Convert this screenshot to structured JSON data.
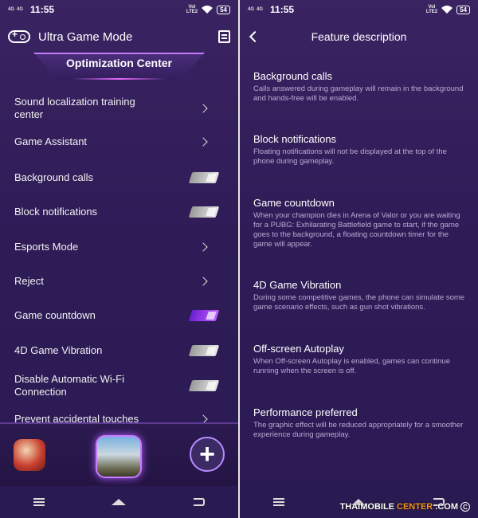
{
  "status_bar": {
    "network": "4G",
    "time": "11:55",
    "volte_top": "Vol",
    "volte_bottom": "LTE2",
    "battery": "54"
  },
  "left_panel": {
    "title": "Ultra Game Mode",
    "section_title": "Optimization Center",
    "items": [
      {
        "label": "Sound localization training center",
        "control": "chevron"
      },
      {
        "label": "Game Assistant",
        "control": "chevron"
      },
      {
        "label": "Background calls",
        "control": "toggle",
        "on": false
      },
      {
        "label": "Block notifications",
        "control": "toggle",
        "on": false
      },
      {
        "label": "Esports Mode",
        "control": "chevron"
      },
      {
        "label": "Reject",
        "control": "chevron"
      },
      {
        "label": "Game countdown",
        "control": "toggle",
        "on": true
      },
      {
        "label": "4D Game Vibration",
        "control": "toggle",
        "on": false
      },
      {
        "label": "Disable Automatic Wi-Fi Connection",
        "control": "toggle",
        "on": false
      },
      {
        "label": "Prevent accidental touches",
        "control": "chevron"
      }
    ],
    "dock": {
      "apps": [
        "game-app-icon-1",
        "game-app-icon-2"
      ],
      "add_icon": "plus-icon"
    }
  },
  "right_panel": {
    "title": "Feature description",
    "features": [
      {
        "name": "Background calls",
        "desc": "Calls answered during gameplay will remain in the background and hands-free will be enabled."
      },
      {
        "name": "Block notifications",
        "desc": "Floating notifications will not be displayed at the top of the phone during gameplay."
      },
      {
        "name": "Game countdown",
        "desc": "When your champion dies in Arena of Valor or you are waiting for a PUBG: Exhilarating Battlefield game to start, if the game goes to the background, a floating countdown timer for the game will appear."
      },
      {
        "name": "4D Game Vibration",
        "desc": "During some competitive games, the phone can simulate some game scenario effects, such as gun shot vibrations."
      },
      {
        "name": "Off-screen Autoplay",
        "desc": "When Off-screen Autoplay is enabled, games can continue running when the screen is off."
      },
      {
        "name": "Performance preferred",
        "desc": "The graphic effect will be reduced appropriately for a smoother experience during gameplay."
      }
    ]
  },
  "watermark": {
    "prefix": "THAIMOBILE",
    "highlight": "CENTER",
    "suffix": ".COM",
    "symbol": "C"
  },
  "colors": {
    "background": "#2f1c57",
    "accent": "#b25cff"
  }
}
